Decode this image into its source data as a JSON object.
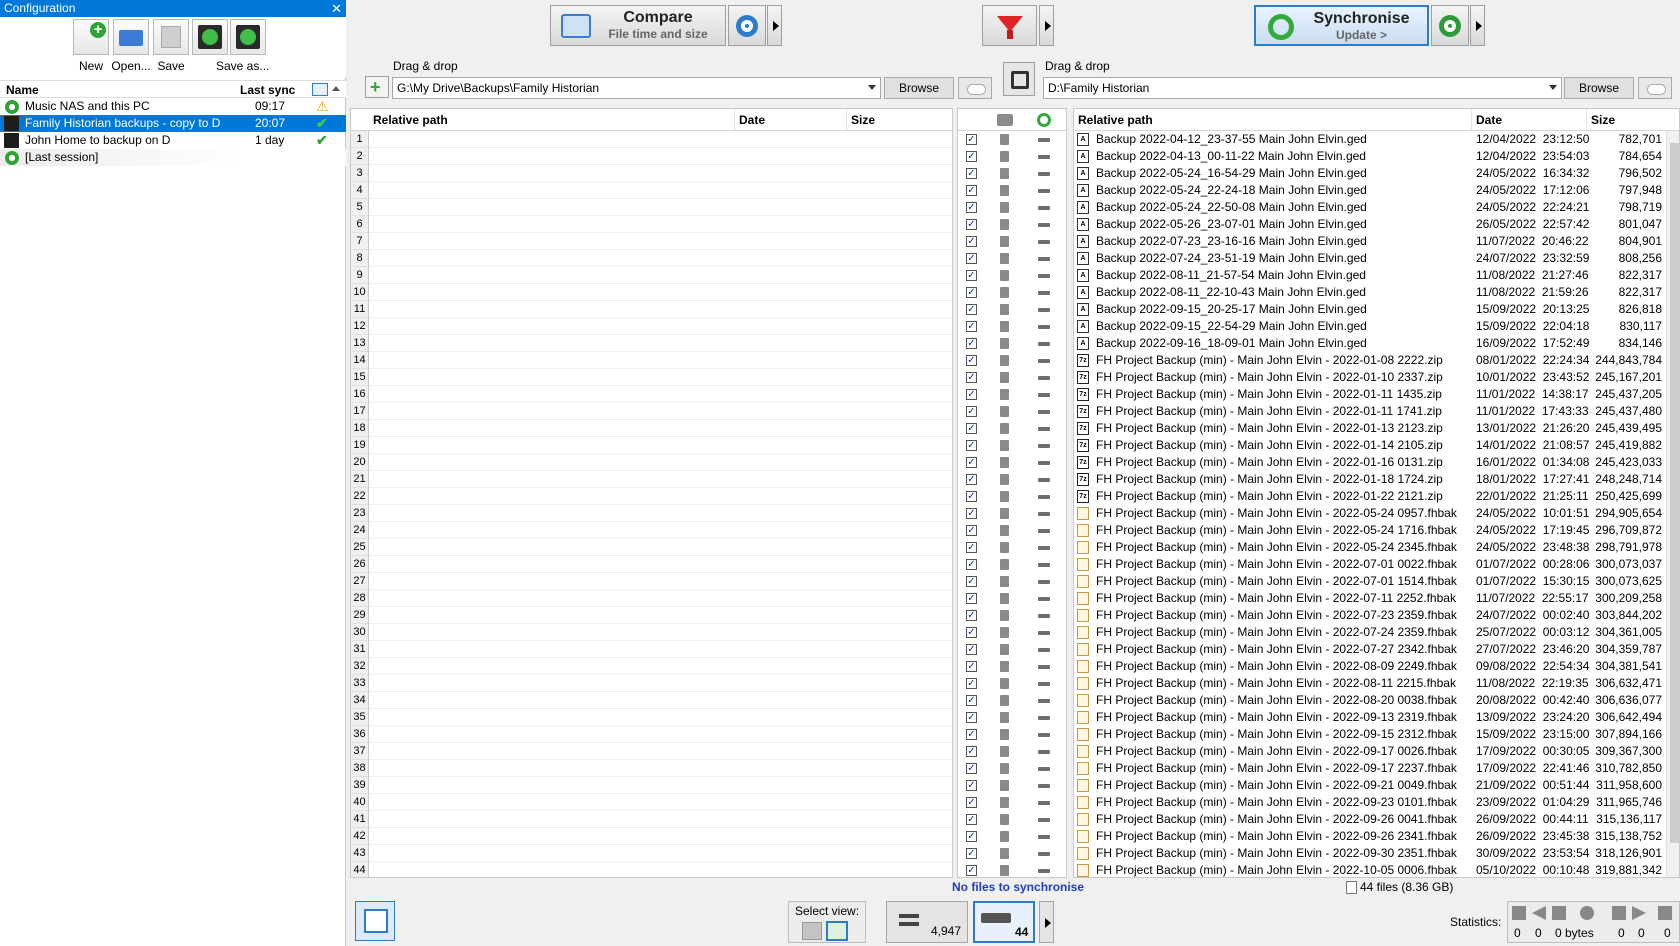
{
  "config_panel": {
    "title": "Configuration",
    "close": "✕",
    "tools": [
      {
        "label": "New"
      },
      {
        "label": "Open..."
      },
      {
        "label": "Save"
      },
      {
        "label": "Save as..."
      }
    ],
    "columns": {
      "name": "Name",
      "last_sync": "Last sync"
    },
    "items": [
      {
        "name": "Music NAS and this PC",
        "last_sync": "09:17",
        "status": "warning"
      },
      {
        "name": "Family Historian backups - copy to D",
        "last_sync": "20:07",
        "status": "ok",
        "selected": true
      },
      {
        "name": "John Home to backup on D",
        "last_sync": "1 day",
        "status": "ok"
      },
      {
        "name": "[Last session]",
        "last_sync": "",
        "status": ""
      }
    ]
  },
  "toolbar": {
    "compare": {
      "title": "Compare",
      "subtitle": "File time and size"
    },
    "synchronise": {
      "title": "Synchronise",
      "subtitle": "Update >"
    }
  },
  "left_path": {
    "label": "Drag & drop",
    "value": "G:\\My Drive\\Backups\\Family Historian",
    "browse": "Browse"
  },
  "right_path": {
    "label": "Drag & drop",
    "value": "D:\\Family Historian",
    "browse": "Browse"
  },
  "left_grid": {
    "columns": {
      "path": "Relative path",
      "date": "Date",
      "size": "Size"
    }
  },
  "right_grid": {
    "columns": {
      "path": "Relative path",
      "date": "Date",
      "size": "Size"
    },
    "rows": [
      {
        "type": "ged",
        "path": "Backup 2022-04-12_23-37-55 Main John Elvin.ged",
        "date": "12/04/2022  23:12:50",
        "size": "782,701"
      },
      {
        "type": "ged",
        "path": "Backup 2022-04-13_00-11-22 Main John Elvin.ged",
        "date": "12/04/2022  23:54:03",
        "size": "784,654"
      },
      {
        "type": "ged",
        "path": "Backup 2022-05-24_16-54-29 Main John Elvin.ged",
        "date": "24/05/2022  16:34:32",
        "size": "796,502"
      },
      {
        "type": "ged",
        "path": "Backup 2022-05-24_22-24-18 Main John Elvin.ged",
        "date": "24/05/2022  17:12:06",
        "size": "797,948"
      },
      {
        "type": "ged",
        "path": "Backup 2022-05-24_22-50-08 Main John Elvin.ged",
        "date": "24/05/2022  22:24:21",
        "size": "798,719"
      },
      {
        "type": "ged",
        "path": "Backup 2022-05-26_23-07-01 Main John Elvin.ged",
        "date": "26/05/2022  22:57:42",
        "size": "801,047"
      },
      {
        "type": "ged",
        "path": "Backup 2022-07-23_23-16-16 Main John Elvin.ged",
        "date": "11/07/2022  20:46:22",
        "size": "804,901"
      },
      {
        "type": "ged",
        "path": "Backup 2022-07-24_23-51-19 Main John Elvin.ged",
        "date": "24/07/2022  23:32:59",
        "size": "808,256"
      },
      {
        "type": "ged",
        "path": "Backup 2022-08-11_21-57-54 Main John Elvin.ged",
        "date": "11/08/2022  21:27:46",
        "size": "822,317"
      },
      {
        "type": "ged",
        "path": "Backup 2022-08-11_22-10-43 Main John Elvin.ged",
        "date": "11/08/2022  21:59:26",
        "size": "822,317"
      },
      {
        "type": "ged",
        "path": "Backup 2022-09-15_20-25-17 Main John Elvin.ged",
        "date": "15/09/2022  20:13:25",
        "size": "826,818"
      },
      {
        "type": "ged",
        "path": "Backup 2022-09-15_22-54-29 Main John Elvin.ged",
        "date": "15/09/2022  22:04:18",
        "size": "830,117"
      },
      {
        "type": "ged",
        "path": "Backup 2022-09-16_18-09-01 Main John Elvin.ged",
        "date": "16/09/2022  17:52:49",
        "size": "834,146"
      },
      {
        "type": "zip",
        "path": "FH Project Backup (min) - Main John Elvin - 2022-01-08 2222.zip",
        "date": "08/01/2022  22:24:34",
        "size": "244,843,784"
      },
      {
        "type": "zip",
        "path": "FH Project Backup (min) - Main John Elvin - 2022-01-10 2337.zip",
        "date": "10/01/2022  23:43:52",
        "size": "245,167,201"
      },
      {
        "type": "zip",
        "path": "FH Project Backup (min) - Main John Elvin - 2022-01-11 1435.zip",
        "date": "11/01/2022  14:38:17",
        "size": "245,437,205"
      },
      {
        "type": "zip",
        "path": "FH Project Backup (min) - Main John Elvin - 2022-01-11 1741.zip",
        "date": "11/01/2022  17:43:33",
        "size": "245,437,480"
      },
      {
        "type": "zip",
        "path": "FH Project Backup (min) - Main John Elvin - 2022-01-13 2123.zip",
        "date": "13/01/2022  21:26:20",
        "size": "245,439,495"
      },
      {
        "type": "zip",
        "path": "FH Project Backup (min) - Main John Elvin - 2022-01-14 2105.zip",
        "date": "14/01/2022  21:08:57",
        "size": "245,419,882"
      },
      {
        "type": "zip",
        "path": "FH Project Backup (min) - Main John Elvin - 2022-01-16 0131.zip",
        "date": "16/01/2022  01:34:08",
        "size": "245,423,033"
      },
      {
        "type": "zip",
        "path": "FH Project Backup (min) - Main John Elvin - 2022-01-18 1724.zip",
        "date": "18/01/2022  17:27:41",
        "size": "248,248,714"
      },
      {
        "type": "zip",
        "path": "FH Project Backup (min) - Main John Elvin - 2022-01-22 2121.zip",
        "date": "22/01/2022  21:25:11",
        "size": "250,425,699"
      },
      {
        "type": "fhb",
        "path": "FH Project Backup (min) - Main John Elvin - 2022-05-24 0957.fhbak",
        "date": "24/05/2022  10:01:51",
        "size": "294,905,654"
      },
      {
        "type": "fhb",
        "path": "FH Project Backup (min) - Main John Elvin - 2022-05-24 1716.fhbak",
        "date": "24/05/2022  17:19:45",
        "size": "296,709,872"
      },
      {
        "type": "fhb",
        "path": "FH Project Backup (min) - Main John Elvin - 2022-05-24 2345.fhbak",
        "date": "24/05/2022  23:48:38",
        "size": "298,791,978"
      },
      {
        "type": "fhb",
        "path": "FH Project Backup (min) - Main John Elvin - 2022-07-01 0022.fhbak",
        "date": "01/07/2022  00:28:06",
        "size": "300,073,037"
      },
      {
        "type": "fhb",
        "path": "FH Project Backup (min) - Main John Elvin - 2022-07-01 1514.fhbak",
        "date": "01/07/2022  15:30:15",
        "size": "300,073,625"
      },
      {
        "type": "fhb",
        "path": "FH Project Backup (min) - Main John Elvin - 2022-07-11 2252.fhbak",
        "date": "11/07/2022  22:55:17",
        "size": "300,209,258"
      },
      {
        "type": "fhb",
        "path": "FH Project Backup (min) - Main John Elvin - 2022-07-23 2359.fhbak",
        "date": "24/07/2022  00:02:40",
        "size": "303,844,202"
      },
      {
        "type": "fhb",
        "path": "FH Project Backup (min) - Main John Elvin - 2022-07-24 2359.fhbak",
        "date": "25/07/2022  00:03:12",
        "size": "304,361,005"
      },
      {
        "type": "fhb",
        "path": "FH Project Backup (min) - Main John Elvin - 2022-07-27 2342.fhbak",
        "date": "27/07/2022  23:46:20",
        "size": "304,359,787"
      },
      {
        "type": "fhb",
        "path": "FH Project Backup (min) - Main John Elvin - 2022-08-09 2249.fhbak",
        "date": "09/08/2022  22:54:34",
        "size": "304,381,541"
      },
      {
        "type": "fhb",
        "path": "FH Project Backup (min) - Main John Elvin - 2022-08-11 2215.fhbak",
        "date": "11/08/2022  22:19:35",
        "size": "306,632,471"
      },
      {
        "type": "fhb",
        "path": "FH Project Backup (min) - Main John Elvin - 2022-08-20 0038.fhbak",
        "date": "20/08/2022  00:42:40",
        "size": "306,636,077"
      },
      {
        "type": "fhb",
        "path": "FH Project Backup (min) - Main John Elvin - 2022-09-13 2319.fhbak",
        "date": "13/09/2022  23:24:20",
        "size": "306,642,494"
      },
      {
        "type": "fhb",
        "path": "FH Project Backup (min) - Main John Elvin - 2022-09-15 2312.fhbak",
        "date": "15/09/2022  23:15:00",
        "size": "307,894,166"
      },
      {
        "type": "fhb",
        "path": "FH Project Backup (min) - Main John Elvin - 2022-09-17 0026.fhbak",
        "date": "17/09/2022  00:30:05",
        "size": "309,367,300"
      },
      {
        "type": "fhb",
        "path": "FH Project Backup (min) - Main John Elvin - 2022-09-17 2237.fhbak",
        "date": "17/09/2022  22:41:46",
        "size": "310,782,850"
      },
      {
        "type": "fhb",
        "path": "FH Project Backup (min) - Main John Elvin - 2022-09-21 0049.fhbak",
        "date": "21/09/2022  00:51:44",
        "size": "311,958,600"
      },
      {
        "type": "fhb",
        "path": "FH Project Backup (min) - Main John Elvin - 2022-09-23 0101.fhbak",
        "date": "23/09/2022  01:04:29",
        "size": "311,965,746"
      },
      {
        "type": "fhb",
        "path": "FH Project Backup (min) - Main John Elvin - 2022-09-26 0041.fhbak",
        "date": "26/09/2022  00:44:11",
        "size": "315,136,117"
      },
      {
        "type": "fhb",
        "path": "FH Project Backup (min) - Main John Elvin - 2022-09-26 2341.fhbak",
        "date": "26/09/2022  23:45:38",
        "size": "315,138,752"
      },
      {
        "type": "fhb",
        "path": "FH Project Backup (min) - Main John Elvin - 2022-09-30 2351.fhbak",
        "date": "30/09/2022  23:53:54",
        "size": "318,126,901"
      },
      {
        "type": "fhb",
        "path": "FH Project Backup (min) - Main John Elvin - 2022-10-05 0006.fhbak",
        "date": "05/10/2022  00:10:48",
        "size": "319,881,342"
      }
    ]
  },
  "status": {
    "center": "No files to synchronise",
    "right": "44 files (8.36 GB)"
  },
  "bottom": {
    "select_view": "Select view:",
    "equal_count": "4,947",
    "right_only_count": "44",
    "statistics_label": "Statistics:",
    "stats": [
      "0",
      "0",
      "0 bytes",
      "0",
      "0",
      "0"
    ]
  },
  "colors": {
    "selection": "#0078d7",
    "status_text": "#1f3fbf",
    "accent_green": "#2f9a3b"
  }
}
